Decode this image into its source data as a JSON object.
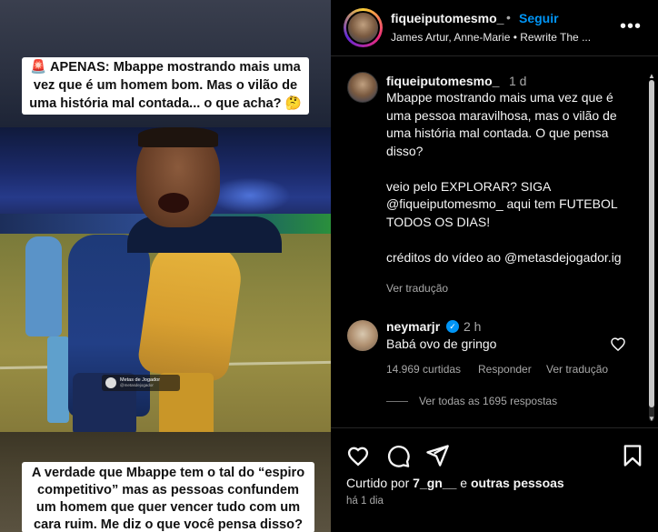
{
  "video": {
    "caption_top": "🚨 APENAS: Mbappe mostrando mais uma vez que é um homem bom. Mas o vilão de uma história mal contada... o que acha? 🤔",
    "caption_bottom": "A verdade que Mbappe tem o tal do “espiro competitivo” mas as pessoas confundem um homem que quer vencer tudo com um cara ruim. Me diz o que você pensa disso?",
    "watermark_line1": "Metas de Jogador",
    "watermark_line2": "@metasdejogador"
  },
  "header": {
    "username": "fiqueiputomesmo_",
    "separator": "•",
    "follow_label": "Seguir",
    "music": "James Artur, Anne-Marie • Rewrite The ...",
    "more_icon": "more-horizontal-icon"
  },
  "caption": {
    "username": "fiqueiputomesmo_",
    "time": "1 d",
    "text": "Mbappe mostrando mais uma vez que é uma pessoa maravilhosa, mas o vilão de uma história mal contada. O que pensa disso?\n\nveio pelo EXPLORAR? SIGA @fiqueiputomesmo_ aqui tem FUTEBOL TODOS OS DIAS!\n\ncréditos do vídeo ao @metasdejogador.ig",
    "translate_label": "Ver tradução"
  },
  "comment": {
    "username": "neymarjr",
    "verified_icon": "verified-badge-icon",
    "time": "2 h",
    "text": "Babá ovo de gringo",
    "likes_label": "14.969 curtidas",
    "reply_label": "Responder",
    "translate_label": "Ver tradução",
    "replies_label": "Ver todas as 1695 respostas"
  },
  "footer": {
    "liked_prefix": "Curtido por ",
    "liked_user": "7_gn__",
    "liked_conj": " e ",
    "liked_others": "outras pessoas",
    "date": "há 1 dia",
    "icons": [
      "heart-icon",
      "comment-icon",
      "share-icon",
      "bookmark-icon"
    ]
  },
  "colors": {
    "background": "#000000",
    "link_blue": "#0095f6",
    "secondary_text": "#a8a8a8"
  }
}
